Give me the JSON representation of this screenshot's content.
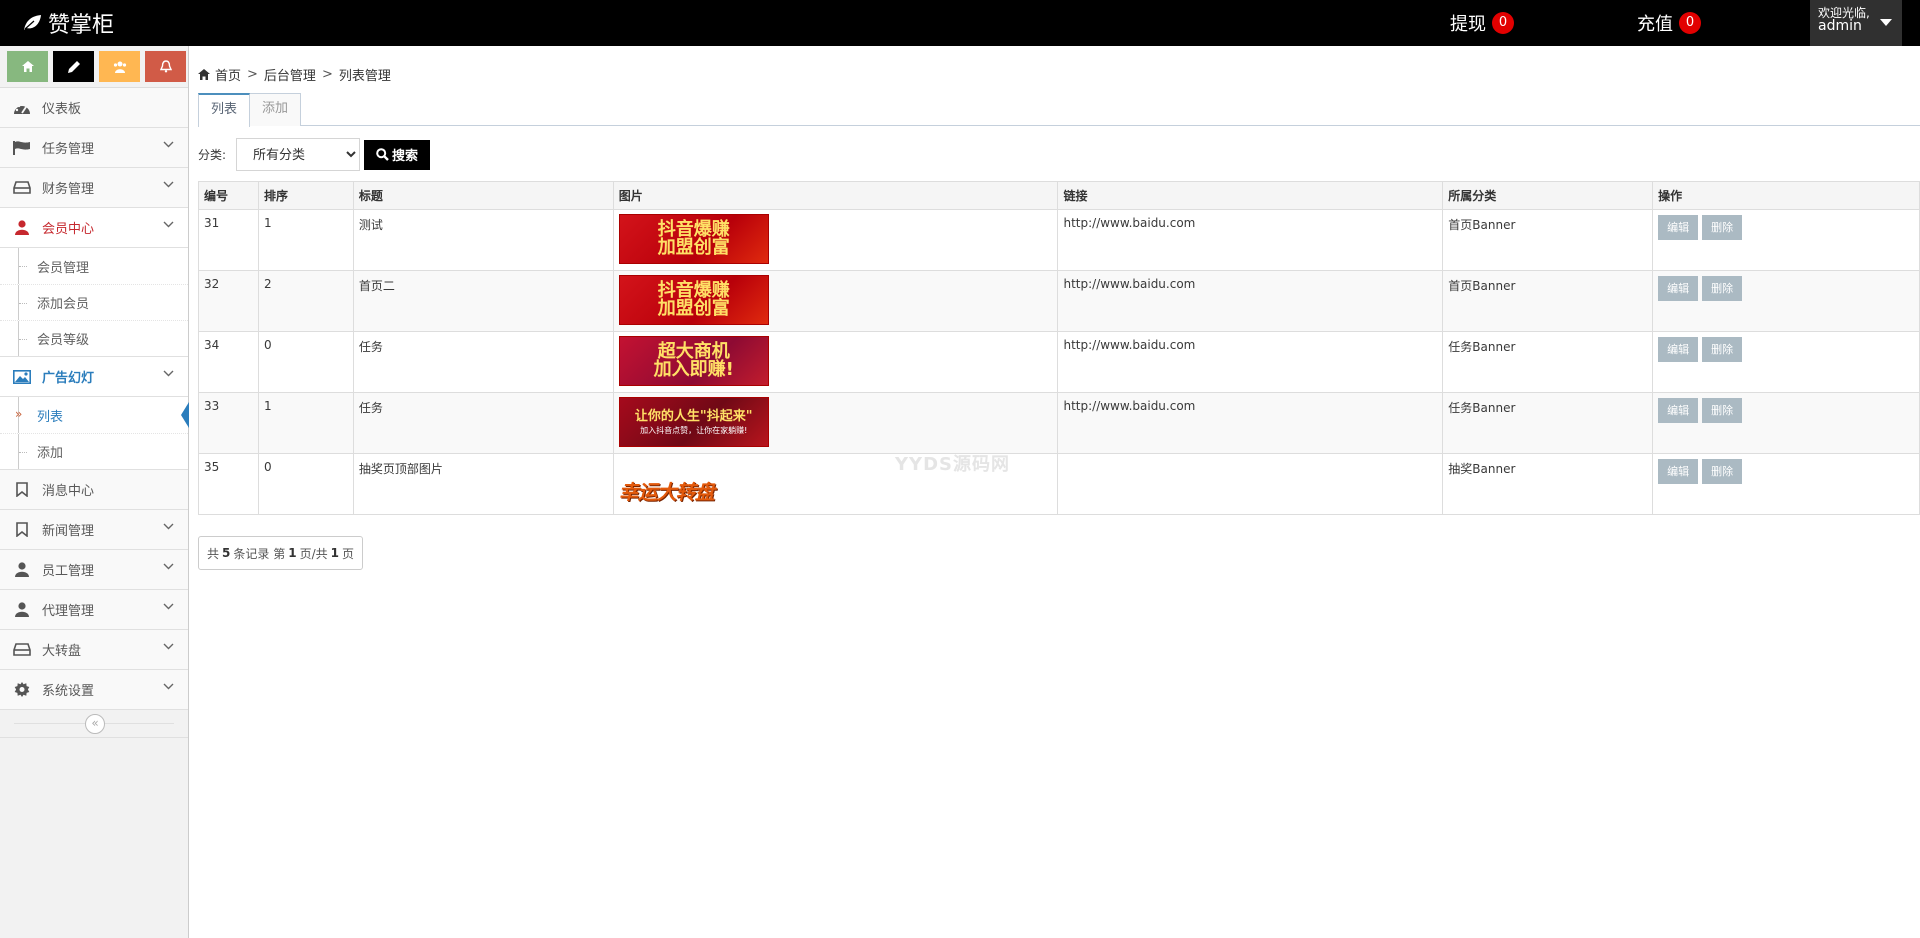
{
  "navbar": {
    "brand": "赞掌柜",
    "withdraw_label": "提现",
    "withdraw_count": "0",
    "recharge_label": "充值",
    "recharge_count": "0",
    "welcome": "欢迎光临,",
    "username": "admin"
  },
  "sidebar": {
    "shortcut_colors": [
      "#87b87f",
      "#000000",
      "#ffb752",
      "#d15b47"
    ],
    "items": [
      {
        "label": "仪表板",
        "icon": "dashboard-icon"
      },
      {
        "label": "任务管理",
        "icon": "flag-icon"
      },
      {
        "label": "财务管理",
        "icon": "inbox-icon"
      },
      {
        "label": "会员中心",
        "icon": "user-icon"
      },
      {
        "label": "广告幻灯",
        "icon": "picture-icon"
      },
      {
        "label": "消息中心",
        "icon": "bookmark-icon"
      },
      {
        "label": "新闻管理",
        "icon": "bookmark-icon"
      },
      {
        "label": "员工管理",
        "icon": "user-icon"
      },
      {
        "label": "代理管理",
        "icon": "user-icon"
      },
      {
        "label": "大转盘",
        "icon": "inbox-icon"
      },
      {
        "label": "系统设置",
        "icon": "gear-icon"
      }
    ],
    "member_sub": [
      "会员管理",
      "添加会员",
      "会员等级"
    ],
    "ad_sub": [
      "列表",
      "添加"
    ]
  },
  "breadcrumb": [
    "首页",
    "后台管理",
    "列表管理"
  ],
  "tabs": [
    "列表",
    "添加"
  ],
  "filter": {
    "label": "分类:",
    "selected": "所有分类",
    "search_label": "搜索"
  },
  "table": {
    "headers": [
      "编号",
      "排序",
      "标题",
      "图片",
      "链接",
      "所属分类",
      "操作"
    ],
    "edit_label": "编辑",
    "delete_label": "删除",
    "rows": [
      {
        "id": "31",
        "sort": "1",
        "title": "测试",
        "link": "http://www.baidu.com",
        "category": "首页Banner",
        "banner_line1": "抖音爆赚",
        "banner_line2": "加盟创富"
      },
      {
        "id": "32",
        "sort": "2",
        "title": "首页二",
        "link": "http://www.baidu.com",
        "category": "首页Banner",
        "banner_line1": "抖音爆赚",
        "banner_line2": "加盟创富"
      },
      {
        "id": "34",
        "sort": "0",
        "title": "任务",
        "link": "http://www.baidu.com",
        "category": "任务Banner",
        "banner_line1": "超大商机",
        "banner_line2": "加入即赚!"
      },
      {
        "id": "33",
        "sort": "1",
        "title": "任务",
        "link": "http://www.baidu.com",
        "category": "任务Banner",
        "banner_line1": "让你的人生\"抖起来\"",
        "banner_line2": "加入抖音点赞，让你在家躺赚!"
      },
      {
        "id": "35",
        "sort": "0",
        "title": "抽奖页顶部图片",
        "link": "",
        "category": "抽奖Banner",
        "banner_line1": "幸运大转盘",
        "banner_line2": ""
      }
    ]
  },
  "watermark": "YYDS源码网",
  "pager": {
    "pre": "共",
    "total": "5",
    "mid1": "条记录 第",
    "page": "1",
    "mid2": "页/共",
    "pages": "1",
    "post": "页"
  }
}
